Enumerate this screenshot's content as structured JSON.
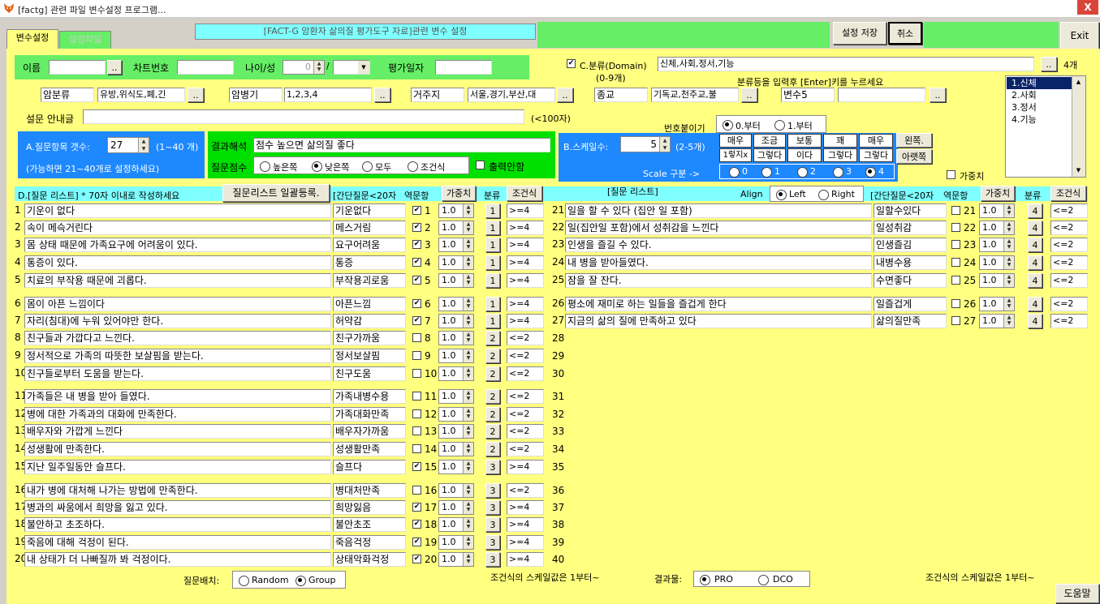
{
  "window": {
    "title": "[factg] 관련 파일 변수설정 프로그램...",
    "close": "X"
  },
  "tabs": [
    "변수설정",
    "설정파일"
  ],
  "banner": "[FACT-G 암환자 삶의질 평가도구 자료]관련 변수 설정",
  "toolbar": {
    "save": "설정 저장",
    "cancel": "취소",
    "exit": "Exit",
    "help": "도움말"
  },
  "patient": {
    "name_label": "이름",
    "chart_label": "차트번호",
    "age_label": "나이/성",
    "age_value": "0",
    "slash": "/",
    "date_label": "평가일자",
    "ellipsis": ".."
  },
  "domain": {
    "label": "C.분류(Domain)",
    "value": "신체,사회,정서,기능",
    "count": "4개",
    "range": "(0-9개)",
    "hint": "분류등을 입력후 [Enter]키를 누르세요",
    "list": [
      "1.신체",
      "2.사회",
      "3.정서",
      "4.기능"
    ]
  },
  "categories": [
    {
      "label": "암분류",
      "value": "유방,위식도,폐,긴"
    },
    {
      "label": "암병기",
      "value": "1,2,3,4"
    },
    {
      "label": "거주지",
      "value": "서울,경기,부산,대"
    },
    {
      "label": "종교",
      "value": "기독교,천주교,불"
    },
    {
      "label": "변수5",
      "value": ""
    }
  ],
  "survey": {
    "label": "설문 안내글",
    "limit": "(<100자)"
  },
  "sectionA": {
    "label": "A.질문항목 갯수:",
    "value": "27",
    "range": "(1~40 개)",
    "note": "(가능하면 21~40개로 설정하세요)"
  },
  "interpret": {
    "label": "결과해석",
    "value": "점수 높으면 삶의질 좋다",
    "score_label": "질문점수",
    "options": [
      "높은쪽",
      "낮은쪽",
      "모두",
      "조건식"
    ],
    "selected": 1,
    "no_output": "출력안함"
  },
  "numbering": {
    "label": "번호붙이기",
    "options": [
      "0.부터",
      "1.부터"
    ]
  },
  "sectionB": {
    "label": "B.스케일수:",
    "value": "5",
    "range": "(2-5개)",
    "scale_label": "Scale 구분 ->",
    "top": [
      "매우",
      "조금",
      "보통",
      "꽤",
      "매우"
    ],
    "bottom": [
      "1렇지x",
      "그렇다",
      "이다",
      "그렇다",
      "그렇다"
    ],
    "nums": [
      "0",
      "1",
      "2",
      "3",
      "4"
    ],
    "left_btn": "왼쪽.",
    "bottom_btn": "아랫쪽",
    "weight": "가중치"
  },
  "listHeader": {
    "title": "D.[질문 리스트] * 70자 이내로 작성하세요",
    "bulk": "질문리스트 일괄등록.",
    "short": "[간단질문<20자",
    "reverse": "역문항",
    "weight": "가중치",
    "category": "분류",
    "condition": "조건식"
  },
  "rightHeader": {
    "title": "[질문 리스트]",
    "align": "Align",
    "left": "Left",
    "right": "Right"
  },
  "questions": [
    {
      "n": "1",
      "q": "기운이 없다",
      "s": "기운없다",
      "c": true,
      "w": "1.0",
      "b": "1",
      "cond": ">=4"
    },
    {
      "n": "2",
      "q": "속이 메슥거린다",
      "s": "메스거림",
      "c": true,
      "w": "1.0",
      "b": "1",
      "cond": ">=4"
    },
    {
      "n": "3",
      "q": "몸 상태 때문에 가족요구에 어려움이 있다.",
      "s": "요구어려움",
      "c": true,
      "w": "1.0",
      "b": "1",
      "cond": ">=4"
    },
    {
      "n": "4",
      "q": "통증이 있다.",
      "s": "통증",
      "c": true,
      "w": "1.0",
      "b": "1",
      "cond": ">=4"
    },
    {
      "n": "5",
      "q": "치료의 부작용 때문에 괴롭다.",
      "s": "부작용괴로움",
      "c": true,
      "w": "1.0",
      "b": "1",
      "cond": ">=4"
    },
    {
      "n": "6",
      "q": "몸이 아픈 느낌이다",
      "s": "아픈느낌",
      "c": true,
      "w": "1.0",
      "b": "1",
      "cond": ">=4"
    },
    {
      "n": "7",
      "q": "자리(침대)에  누워 있어야만 한다.",
      "s": "허약감",
      "c": true,
      "w": "1.0",
      "b": "1",
      "cond": ">=4"
    },
    {
      "n": "8",
      "q": "친구들과 가깝다고 느낀다.",
      "s": "친구가까움",
      "c": false,
      "w": "1.0",
      "b": "2",
      "cond": "<=2"
    },
    {
      "n": "9",
      "q": "정서적으로 가족의 따뜻한 보살핌을 받는다.",
      "s": "정서보살핌",
      "c": false,
      "w": "1.0",
      "b": "2",
      "cond": "<=2"
    },
    {
      "n": "10",
      "q": "친구들로부터 도움을 받는다.",
      "s": "친구도움",
      "c": false,
      "w": "1.0",
      "b": "2",
      "cond": "<=2"
    },
    {
      "n": "11",
      "q": "가족들은 내 병을 받아 들였다.",
      "s": "가족내병수용",
      "c": false,
      "w": "1.0",
      "b": "2",
      "cond": "<=2"
    },
    {
      "n": "12",
      "q": "병에 대한 가족과의 대화에 만족한다.",
      "s": "가족대화만족",
      "c": false,
      "w": "1.0",
      "b": "2",
      "cond": "<=2"
    },
    {
      "n": "13",
      "q": "배우자와 가깝게 느낀다",
      "s": "배우자가까움",
      "c": false,
      "w": "1.0",
      "b": "2",
      "cond": "<=2"
    },
    {
      "n": "14",
      "q": "성생활에 만족한다.",
      "s": "성생활만족",
      "c": false,
      "w": "1.0",
      "b": "2",
      "cond": "<=2"
    },
    {
      "n": "15",
      "q": "지난 일주일동안 슬프다.",
      "s": "슬프다",
      "c": true,
      "w": "1.0",
      "b": "3",
      "cond": ">=4"
    },
    {
      "n": "16",
      "q": "내가 병에 대처해 나가는 방법에 만족한다.",
      "s": "병대처만족",
      "c": false,
      "w": "1.0",
      "b": "3",
      "cond": "<=2"
    },
    {
      "n": "17",
      "q": "병과의 싸움에서 희망을 잃고 있다.",
      "s": "희망잃음",
      "c": true,
      "w": "1.0",
      "b": "3",
      "cond": ">=4"
    },
    {
      "n": "18",
      "q": "불안하고 초조하다.",
      "s": "불안초조",
      "c": true,
      "w": "1.0",
      "b": "3",
      "cond": ">=4"
    },
    {
      "n": "19",
      "q": "죽음에 대해 걱정이 된다.",
      "s": "죽음걱정",
      "c": true,
      "w": "1.0",
      "b": "3",
      "cond": ">=4"
    },
    {
      "n": "20",
      "q": "내 상태가 더 나빠질까 봐 걱정이다.",
      "s": "상태악화걱정",
      "c": true,
      "w": "1.0",
      "b": "3",
      "cond": ">=4"
    }
  ],
  "questionsRight": [
    {
      "n": "21",
      "q": "일을 할 수 있다 (집안 일 포함)",
      "s": "일할수있다",
      "c": false,
      "w": "1.0",
      "b": "4",
      "cond": "<=2"
    },
    {
      "n": "22",
      "q": "일(집안일  포함)에서 성취감을 느낀다",
      "s": "일성취감",
      "c": false,
      "w": "1.0",
      "b": "4",
      "cond": "<=2"
    },
    {
      "n": "23",
      "q": "인생을 즐길 수 있다.",
      "s": "인생즐김",
      "c": false,
      "w": "1.0",
      "b": "4",
      "cond": "<=2"
    },
    {
      "n": "24",
      "q": "내 병을 받아들였다.",
      "s": "내병수용",
      "c": false,
      "w": "1.0",
      "b": "4",
      "cond": "<=2"
    },
    {
      "n": "25",
      "q": "잠을 잘 잔다.",
      "s": "수면좋다",
      "c": false,
      "w": "1.0",
      "b": "4",
      "cond": "<=2"
    },
    {
      "n": "26",
      "q": "평소에 재미로 하는 일들을 즐겁게 한다",
      "s": "일즐겁게",
      "c": false,
      "w": "1.0",
      "b": "4",
      "cond": "<=2"
    },
    {
      "n": "27",
      "q": "지금의 삶의 질에 만족하고 있다",
      "s": "삶의질만족",
      "c": false,
      "w": "1.0",
      "b": "4",
      "cond": "<=2"
    }
  ],
  "extraNums": [
    "28",
    "29",
    "30",
    "31",
    "32",
    "33",
    "34",
    "35",
    "36",
    "37",
    "38",
    "39",
    "40"
  ],
  "footer": {
    "arrange_label": "질문배치:",
    "random": "Random",
    "group": "Group",
    "scale_note": "조건식의 스케일값은 1부터~",
    "result_label": "결과물:",
    "pro": "PRO",
    "dco": "DCO",
    "scale_note2": "조건식의 스케일값은 1부터~"
  }
}
